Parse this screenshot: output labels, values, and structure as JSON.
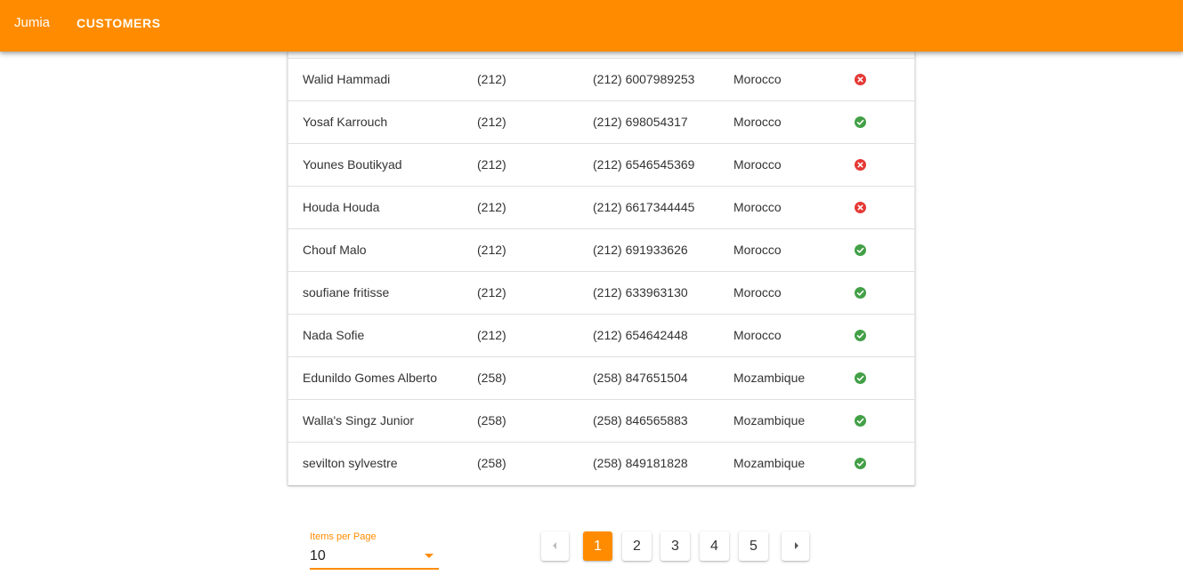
{
  "appbar": {
    "brand": "Jumia",
    "nav_customers": "CUSTOMERS",
    "color": "#ff8c00"
  },
  "table": {
    "rows": [
      {
        "name": "Walid Hammadi",
        "code": "(212)",
        "phone": "(212) 6007989253",
        "country": "Morocco",
        "status": "invalid"
      },
      {
        "name": "Yosaf Karrouch",
        "code": "(212)",
        "phone": "(212) 698054317",
        "country": "Morocco",
        "status": "valid"
      },
      {
        "name": "Younes Boutikyad",
        "code": "(212)",
        "phone": "(212) 6546545369",
        "country": "Morocco",
        "status": "invalid"
      },
      {
        "name": "Houda Houda",
        "code": "(212)",
        "phone": "(212) 6617344445",
        "country": "Morocco",
        "status": "invalid"
      },
      {
        "name": "Chouf Malo",
        "code": "(212)",
        "phone": "(212) 691933626",
        "country": "Morocco",
        "status": "valid"
      },
      {
        "name": "soufiane fritisse",
        "code": "(212)",
        "phone": "(212) 633963130",
        "country": "Morocco",
        "status": "valid"
      },
      {
        "name": "Nada Sofie",
        "code": "(212)",
        "phone": "(212) 654642448",
        "country": "Morocco",
        "status": "valid"
      },
      {
        "name": "Edunildo Gomes Alberto",
        "code": "(258)",
        "phone": "(258) 847651504",
        "country": "Mozambique",
        "status": "valid"
      },
      {
        "name": "Walla's Singz Junior",
        "code": "(258)",
        "phone": "(258) 846565883",
        "country": "Mozambique",
        "status": "valid"
      },
      {
        "name": "sevilton sylvestre",
        "code": "(258)",
        "phone": "(258) 849181828",
        "country": "Mozambique",
        "status": "valid"
      }
    ],
    "status_colors": {
      "valid": "#43a047",
      "invalid": "#e53935"
    }
  },
  "footer": {
    "items_per_page_label": "Items per Page",
    "items_per_page_value": "10",
    "pagination": {
      "pages": [
        "1",
        "2",
        "3",
        "4",
        "5"
      ],
      "current": "1",
      "prev_icon": "chevron-left-icon",
      "next_icon": "chevron-right-icon"
    }
  }
}
